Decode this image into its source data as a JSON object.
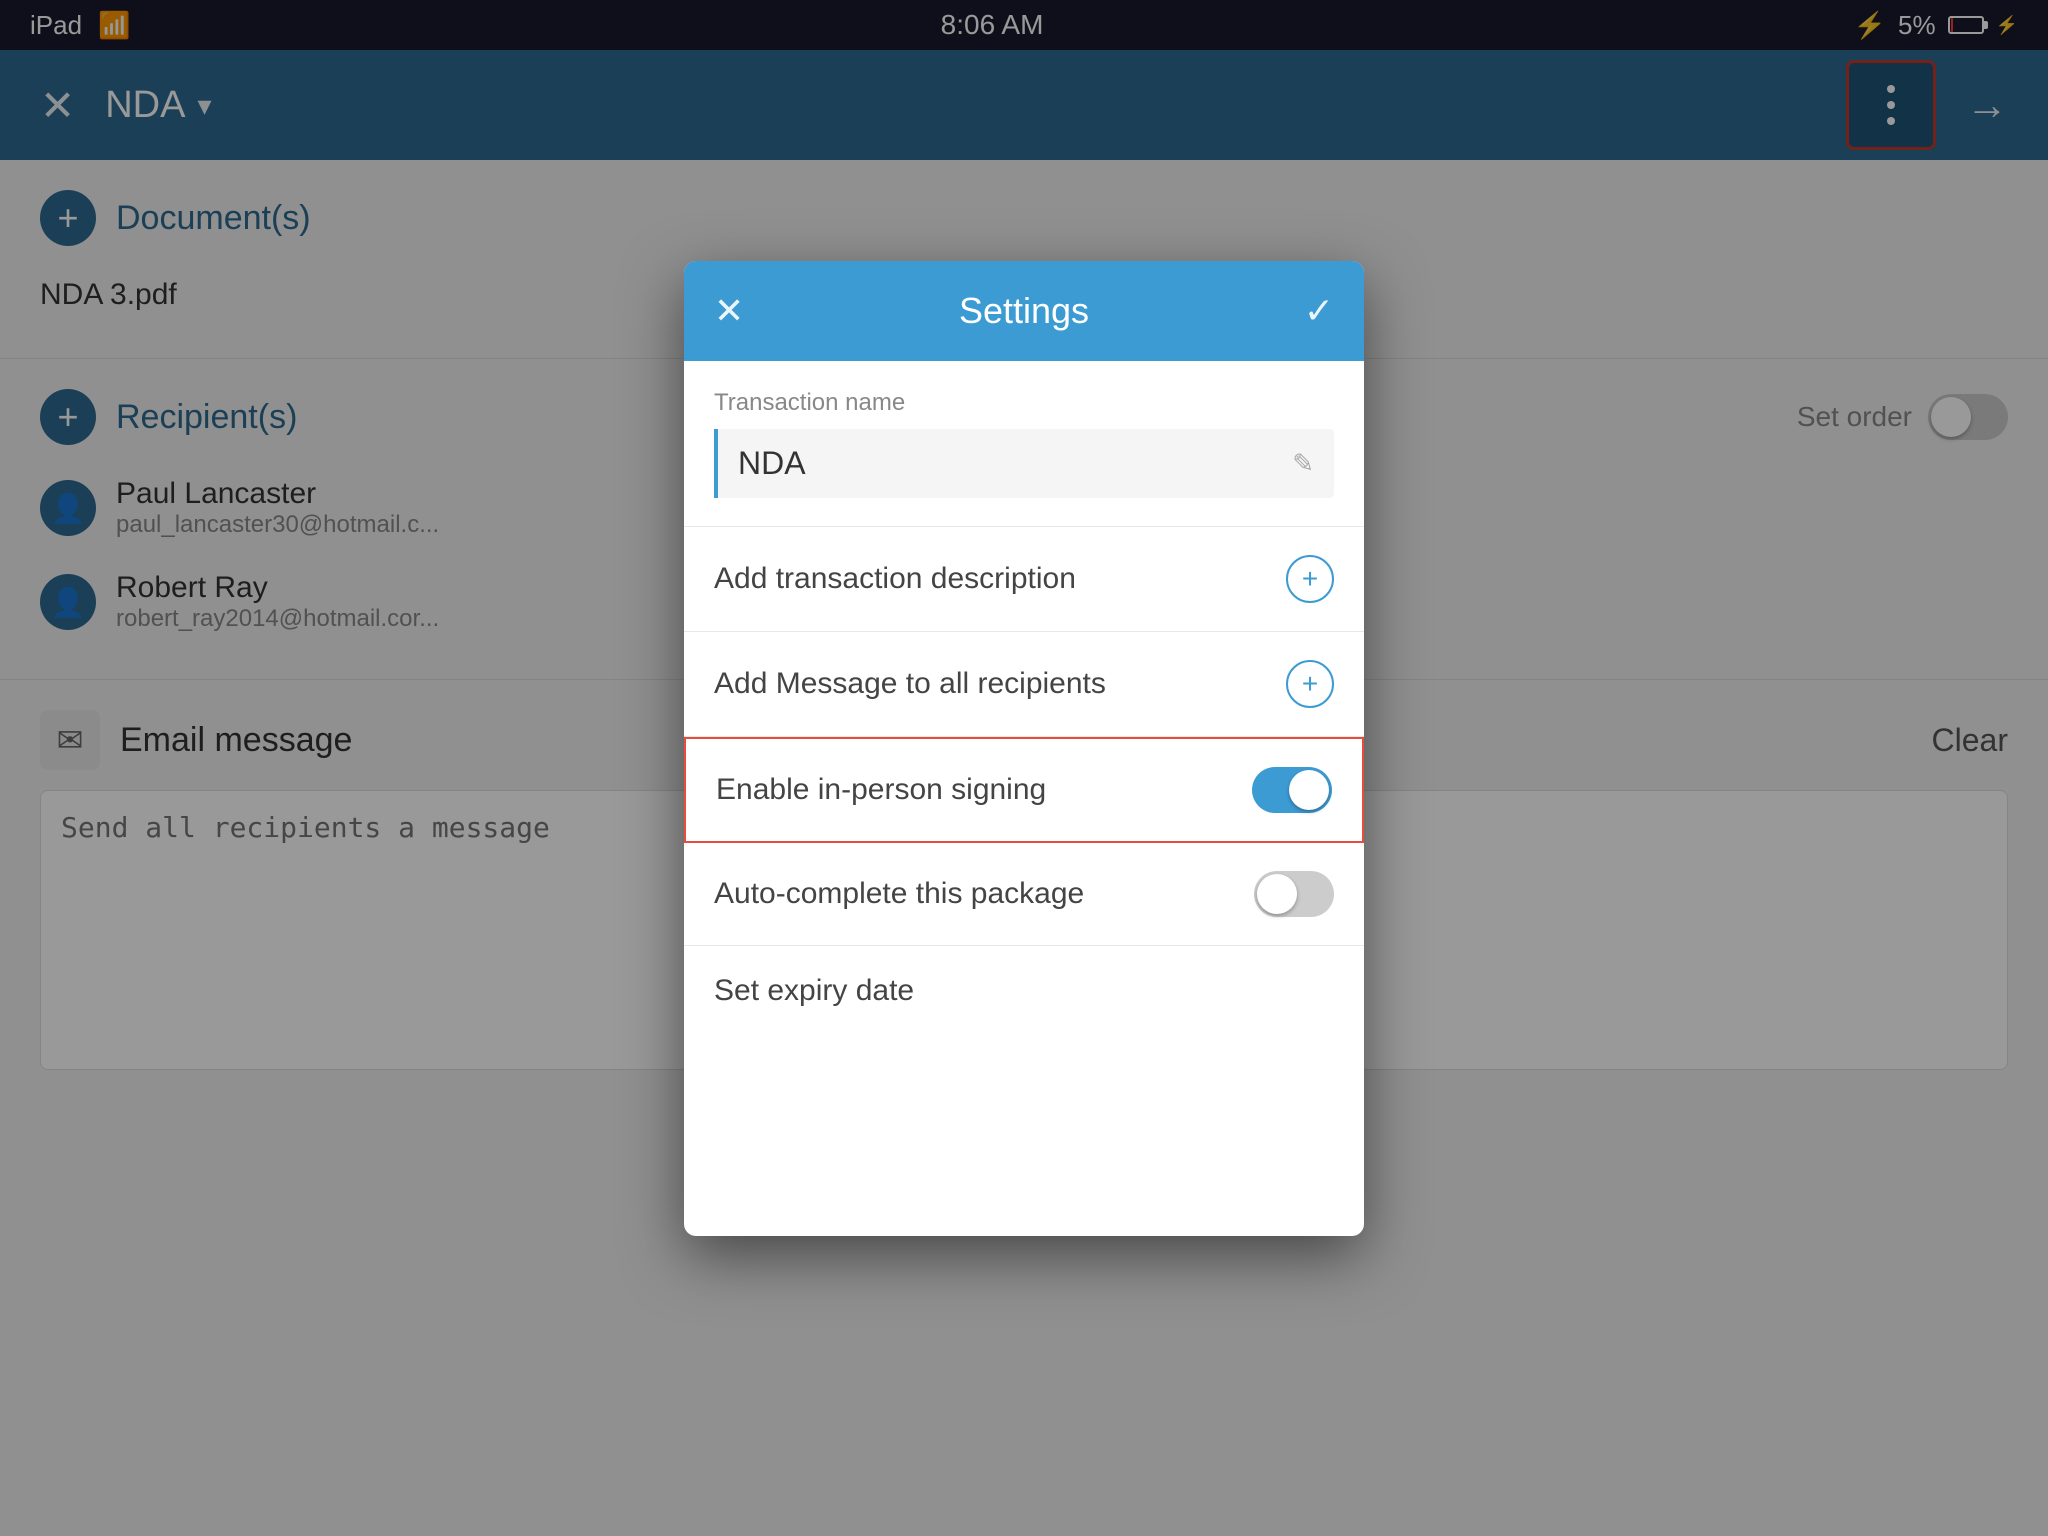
{
  "statusBar": {
    "carrier": "iPad",
    "wifi": "wifi",
    "time": "8:06 AM",
    "bluetooth": "BT",
    "battery_pct": "5%"
  },
  "appHeader": {
    "close_label": "✕",
    "title": "NDA",
    "chevron": "▾",
    "more_icon": "more",
    "arrow_label": "→"
  },
  "sidebar": {
    "documents_label": "Document(s)",
    "file_name": "NDA 3.pdf",
    "recipients_label": "Recipient(s)",
    "set_order_label": "Set order",
    "recipients": [
      {
        "name": "Paul Lancaster",
        "email": "paul_lancaster30@hotmail.c..."
      },
      {
        "name": "Robert Ray",
        "email": "robert_ray2014@hotmail.cor..."
      }
    ],
    "email_section": {
      "title": "Email message",
      "clear_label": "Clear",
      "placeholder": "Send all recipients a message"
    }
  },
  "settingsModal": {
    "title": "Settings",
    "close_label": "✕",
    "confirm_label": "✓",
    "transaction_name_label": "Transaction name",
    "transaction_name_value": "NDA",
    "edit_icon": "✎",
    "add_description_label": "Add transaction description",
    "add_message_label": "Add Message to all recipients",
    "enable_inperson_label": "Enable in-person signing",
    "enable_inperson_on": true,
    "autocomplete_label": "Auto-complete this package",
    "autocomplete_on": false,
    "expiry_label": "Set expiry date"
  },
  "colors": {
    "header_bg": "#2d6a8f",
    "modal_header_bg": "#3d9bd4",
    "accent": "#3d9bd4",
    "highlight_border": "#e74c3c"
  }
}
